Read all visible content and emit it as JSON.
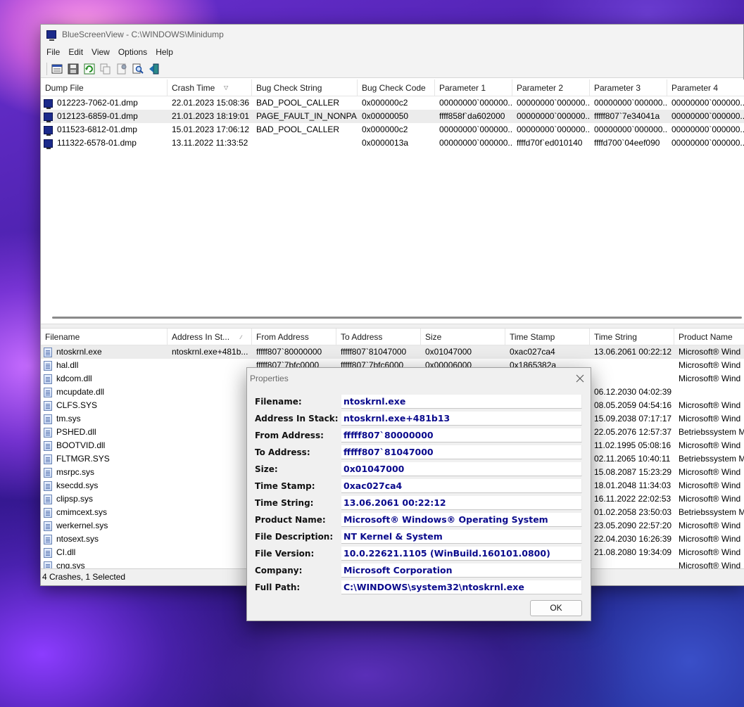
{
  "window": {
    "title": "BlueScreenView  -  C:\\WINDOWS\\Minidump"
  },
  "menu": [
    "File",
    "Edit",
    "View",
    "Options",
    "Help"
  ],
  "toolbar": {
    "buttons": [
      "properties-icon",
      "save-icon",
      "refresh-icon",
      "copy-icon",
      "html-report-icon",
      "find-icon",
      "exit-icon"
    ]
  },
  "crash_list": {
    "columns": [
      "Dump File",
      "Crash Time",
      "Bug Check String",
      "Bug Check Code",
      "Parameter 1",
      "Parameter 2",
      "Parameter 3",
      "Parameter 4"
    ],
    "rows": [
      [
        "012223-7062-01.dmp",
        "22.01.2023 15:08:36",
        "BAD_POOL_CALLER",
        "0x000000c2",
        "00000000`000000...",
        "00000000`000000...",
        "00000000`000000...",
        "00000000`000000..."
      ],
      [
        "012123-6859-01.dmp",
        "21.01.2023 18:19:01",
        "PAGE_FAULT_IN_NONPA...",
        "0x00000050",
        "ffff858f`da602000",
        "00000000`000000...",
        "fffff807`7e34041a",
        "00000000`000000..."
      ],
      [
        "011523-6812-01.dmp",
        "15.01.2023 17:06:12",
        "BAD_POOL_CALLER",
        "0x000000c2",
        "00000000`000000...",
        "00000000`000000...",
        "00000000`000000...",
        "00000000`000000..."
      ],
      [
        "111322-6578-01.dmp",
        "13.11.2022 11:33:52",
        "",
        "0x0000013a",
        "00000000`000000...",
        "ffffd70f`ed010140",
        "ffffd700`04eef090",
        "00000000`000000..."
      ]
    ],
    "selected_index": 1,
    "sort_marker": "▽"
  },
  "module_list": {
    "columns": [
      "Filename",
      "Address In St...",
      "From Address",
      "To Address",
      "Size",
      "Time Stamp",
      "Time String",
      "Product Name"
    ],
    "sort_marker": "∕",
    "rows": [
      [
        "ntoskrnl.exe",
        "ntoskrnl.exe+481b...",
        "fffff807`80000000",
        "fffff807`81047000",
        "0x01047000",
        "0xac027ca4",
        "13.06.2061 00:22:12",
        "Microsoft® Wind"
      ],
      [
        "hal.dll",
        "",
        "fffff807`7bfc0000",
        "fffff807`7bfc6000",
        "0x00006000",
        "0x1865382a",
        "",
        "Microsoft® Wind"
      ],
      [
        "kdcom.dll",
        "",
        "",
        "",
        "",
        "",
        "",
        "Microsoft® Wind"
      ],
      [
        "mcupdate.dll",
        "",
        "",
        "",
        "",
        "",
        "06.12.2030 04:02:39",
        ""
      ],
      [
        "CLFS.SYS",
        "",
        "",
        "",
        "",
        "",
        "08.05.2059 04:54:16",
        "Microsoft® Wind"
      ],
      [
        "tm.sys",
        "",
        "",
        "",
        "",
        "",
        "15.09.2038 07:17:17",
        "Microsoft® Wind"
      ],
      [
        "PSHED.dll",
        "",
        "",
        "",
        "",
        "",
        "22.05.2076 12:57:37",
        "Betriebssystem M"
      ],
      [
        "BOOTVID.dll",
        "",
        "",
        "",
        "",
        "",
        "11.02.1995 05:08:16",
        "Microsoft® Wind"
      ],
      [
        "FLTMGR.SYS",
        "",
        "",
        "",
        "",
        "",
        "02.11.2065 10:40:11",
        "Betriebssystem M"
      ],
      [
        "msrpc.sys",
        "",
        "",
        "",
        "",
        "",
        "15.08.2087 15:23:29",
        "Microsoft® Wind"
      ],
      [
        "ksecdd.sys",
        "",
        "",
        "",
        "",
        "",
        "18.01.2048 11:34:03",
        "Microsoft® Wind"
      ],
      [
        "clipsp.sys",
        "",
        "",
        "",
        "",
        "",
        "16.11.2022 22:02:53",
        "Microsoft® Wind"
      ],
      [
        "cmimcext.sys",
        "",
        "",
        "",
        "",
        "",
        "01.02.2058 23:50:03",
        "Betriebssystem M"
      ],
      [
        "werkernel.sys",
        "",
        "",
        "",
        "",
        "",
        "23.05.2090 22:57:20",
        "Microsoft® Wind"
      ],
      [
        "ntosext.sys",
        "",
        "",
        "",
        "",
        "",
        "22.04.2030 16:26:39",
        "Microsoft® Wind"
      ],
      [
        "CI.dll",
        "",
        "",
        "",
        "",
        "",
        "21.08.2080 19:34:09",
        "Microsoft® Wind"
      ],
      [
        "cng.sys",
        "",
        "",
        "",
        "",
        "",
        "",
        "Microsoft® Wind"
      ]
    ],
    "selected_index": 0
  },
  "status": {
    "text": "4 Crashes, 1 Selected"
  },
  "properties_dialog": {
    "title": "Properties",
    "fields": [
      {
        "label": "Filename:",
        "value": "ntoskrnl.exe"
      },
      {
        "label": "Address In Stack:",
        "value": "ntoskrnl.exe+481b13"
      },
      {
        "label": "From Address:",
        "value": "fffff807`80000000"
      },
      {
        "label": "To Address:",
        "value": "fffff807`81047000"
      },
      {
        "label": "Size:",
        "value": "0x01047000"
      },
      {
        "label": "Time Stamp:",
        "value": "0xac027ca4"
      },
      {
        "label": "Time String:",
        "value": "13.06.2061 00:22:12"
      },
      {
        "label": "Product Name:",
        "value": "Microsoft® Windows® Operating System"
      },
      {
        "label": "File Description:",
        "value": "NT Kernel & System"
      },
      {
        "label": "File Version:",
        "value": "10.0.22621.1105 (WinBuild.160101.0800)"
      },
      {
        "label": "Company:",
        "value": "Microsoft Corporation"
      },
      {
        "label": "Full Path:",
        "value": "C:\\WINDOWS\\system32\\ntoskrnl.exe"
      }
    ],
    "ok_label": "OK",
    "close_glyph": "✕"
  },
  "colors": {
    "value_text": "#0a0a8c",
    "dump_icon": "#1b2a8a",
    "selected_row": "#ececec"
  }
}
